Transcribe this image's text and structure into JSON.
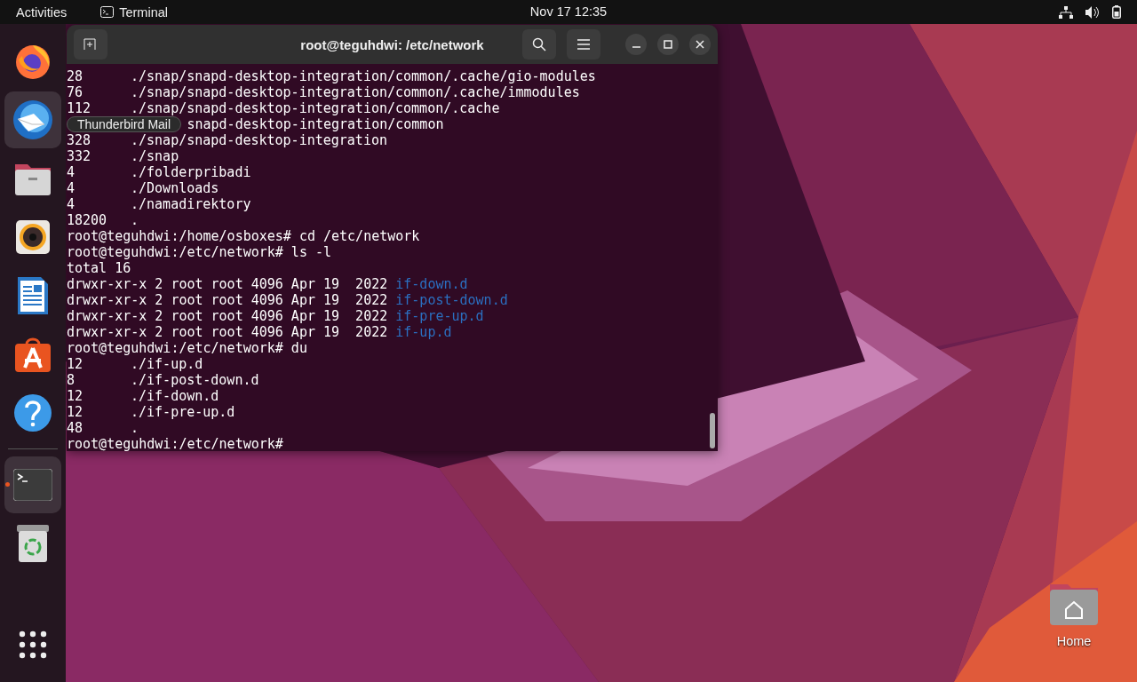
{
  "top_bar": {
    "activities": "Activities",
    "app_name": "Terminal",
    "clock": "Nov 17  12:35"
  },
  "dock": {
    "items": [
      {
        "kind": "firefox",
        "highlighted": false,
        "running": false
      },
      {
        "kind": "mail",
        "highlighted": true,
        "running": false
      },
      {
        "kind": "files",
        "highlighted": false,
        "running": false
      },
      {
        "kind": "music",
        "highlighted": false,
        "running": false
      },
      {
        "kind": "writer",
        "highlighted": false,
        "running": false
      },
      {
        "kind": "store",
        "highlighted": false,
        "running": false
      },
      {
        "kind": "help",
        "highlighted": false,
        "running": false
      },
      {
        "kind": "terminal",
        "highlighted": true,
        "running": true
      },
      {
        "kind": "trash",
        "highlighted": false,
        "running": false
      }
    ],
    "tooltip": "Thunderbird Mail"
  },
  "terminal": {
    "title": "root@teguhdwi: /etc/network",
    "lines": [
      {
        "kind": "du",
        "size": "28",
        "path": "./snap/snapd-desktop-integration/common/.cache/gio-modules"
      },
      {
        "kind": "du",
        "size": "76",
        "path": "./snap/snapd-desktop-integration/common/.cache/immodules"
      },
      {
        "kind": "du",
        "size": "112",
        "path": "./snap/snapd-desktop-integration/common/.cache"
      },
      {
        "kind": "covered",
        "path": "snapd-desktop-integration/common"
      },
      {
        "kind": "du",
        "size": "328",
        "path": "./snap/snapd-desktop-integration"
      },
      {
        "kind": "du",
        "size": "332",
        "path": "./snap"
      },
      {
        "kind": "du",
        "size": "4",
        "path": "./folderpribadi"
      },
      {
        "kind": "du",
        "size": "4",
        "path": "./Downloads"
      },
      {
        "kind": "du",
        "size": "4",
        "path": "./namadirektory"
      },
      {
        "kind": "du",
        "size": "18200",
        "path": "."
      },
      {
        "kind": "text",
        "text": "root@teguhdwi:/home/osboxes# cd /etc/network"
      },
      {
        "kind": "text",
        "text": "root@teguhdwi:/etc/network# ls -l"
      },
      {
        "kind": "text",
        "text": "total 16"
      },
      {
        "kind": "ls",
        "text": "drwxr-xr-x 2 root root 4096 Apr 19  2022",
        "name": "if-down.d"
      },
      {
        "kind": "ls",
        "text": "drwxr-xr-x 2 root root 4096 Apr 19  2022",
        "name": "if-post-down.d"
      },
      {
        "kind": "ls",
        "text": "drwxr-xr-x 2 root root 4096 Apr 19  2022",
        "name": "if-pre-up.d"
      },
      {
        "kind": "ls",
        "text": "drwxr-xr-x 2 root root 4096 Apr 19  2022",
        "name": "if-up.d"
      },
      {
        "kind": "text",
        "text": "root@teguhdwi:/etc/network# du"
      },
      {
        "kind": "du",
        "size": "12",
        "path": "./if-up.d"
      },
      {
        "kind": "du",
        "size": "8",
        "path": "./if-post-down.d"
      },
      {
        "kind": "du",
        "size": "12",
        "path": "./if-down.d"
      },
      {
        "kind": "du",
        "size": "12",
        "path": "./if-pre-up.d"
      },
      {
        "kind": "du",
        "size": "48",
        "path": "."
      },
      {
        "kind": "text",
        "text": "root@teguhdwi:/etc/network#"
      }
    ]
  },
  "desktop_icons": [
    {
      "label": "Home"
    }
  ]
}
